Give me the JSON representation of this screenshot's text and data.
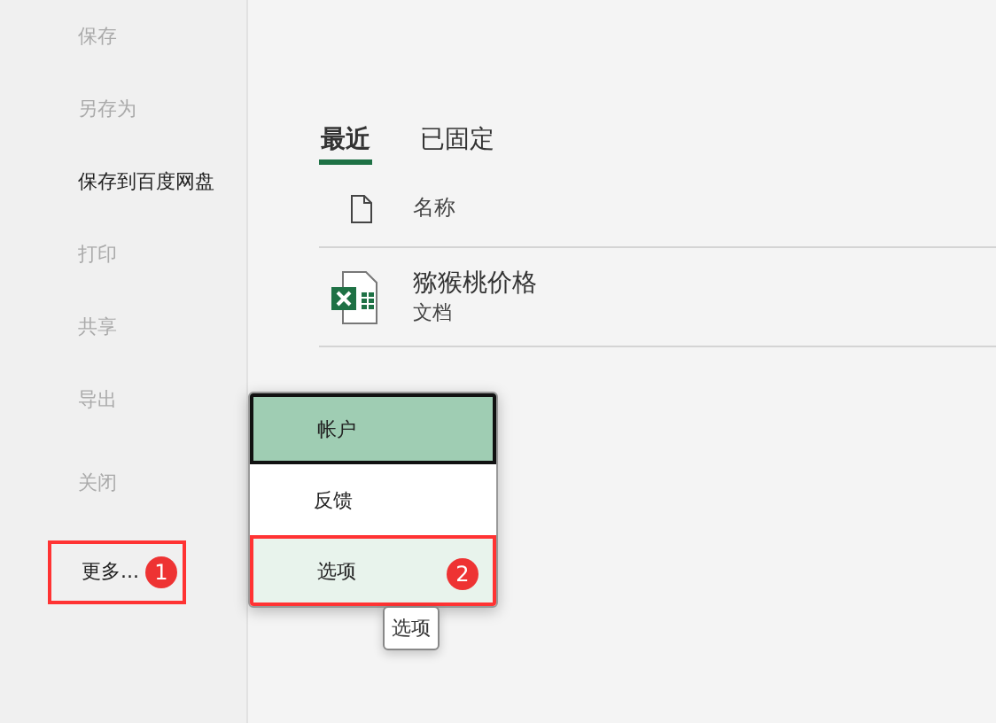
{
  "sidebar": {
    "items": [
      {
        "label": "保存",
        "disabled": true
      },
      {
        "label": "另存为",
        "disabled": true
      },
      {
        "label": "保存到百度网盘",
        "disabled": false
      },
      {
        "label": "打印",
        "disabled": true
      },
      {
        "label": "共享",
        "disabled": true
      },
      {
        "label": "导出",
        "disabled": true
      },
      {
        "label": "关闭",
        "disabled": true
      },
      {
        "label": "更多...",
        "disabled": false,
        "marker": "1"
      }
    ]
  },
  "tabs": [
    {
      "label": "最近",
      "selected": true
    },
    {
      "label": "已固定",
      "selected": false
    }
  ],
  "file_list": {
    "columns": [
      "名称"
    ],
    "rows": [
      {
        "name": "猕猴桃价格",
        "location": "文档"
      }
    ]
  },
  "menu": {
    "items": [
      {
        "label": "帐户",
        "kind": "focused"
      },
      {
        "label": "反馈",
        "kind": "plain"
      },
      {
        "label": "选项",
        "kind": "hovered",
        "marker": "2"
      }
    ]
  },
  "tooltip": "选项"
}
